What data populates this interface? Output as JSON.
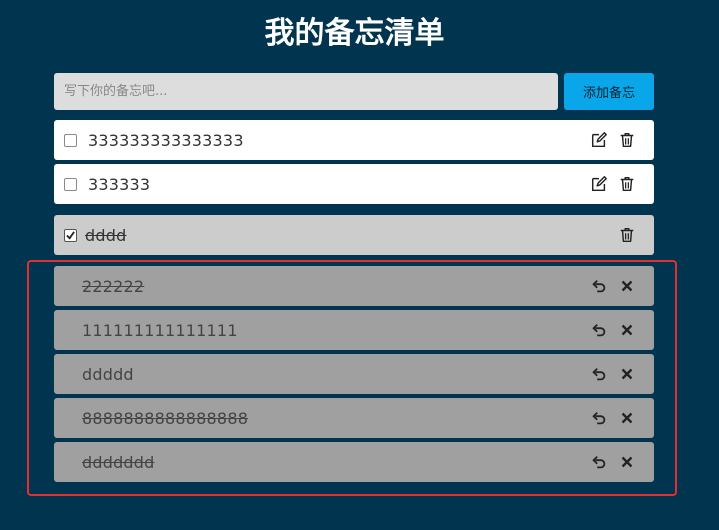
{
  "header": {
    "title": "我的备忘清单"
  },
  "input": {
    "placeholder": "写下你的备忘吧...",
    "value": ""
  },
  "add_button": {
    "label": "添加备忘"
  },
  "active_items": [
    {
      "text": "333333333333333",
      "checked": false
    },
    {
      "text": "333333",
      "checked": false
    }
  ],
  "completed_items": [
    {
      "text": "dddd",
      "checked": true
    }
  ],
  "deleted_items": [
    {
      "text": "222222",
      "strike": true
    },
    {
      "text": "111111111111111",
      "strike": false
    },
    {
      "text": "ddddd",
      "strike": false
    },
    {
      "text": "8888888888888888",
      "strike": true
    },
    {
      "text": "ddddddd",
      "strike": true
    }
  ],
  "icons": {
    "edit": "edit-icon",
    "delete": "trash-icon",
    "restore": "undo-icon",
    "remove": "close-icon"
  },
  "colors": {
    "background": "#00344f",
    "accent": "#0aa6ea",
    "highlight_border": "#e03030"
  }
}
